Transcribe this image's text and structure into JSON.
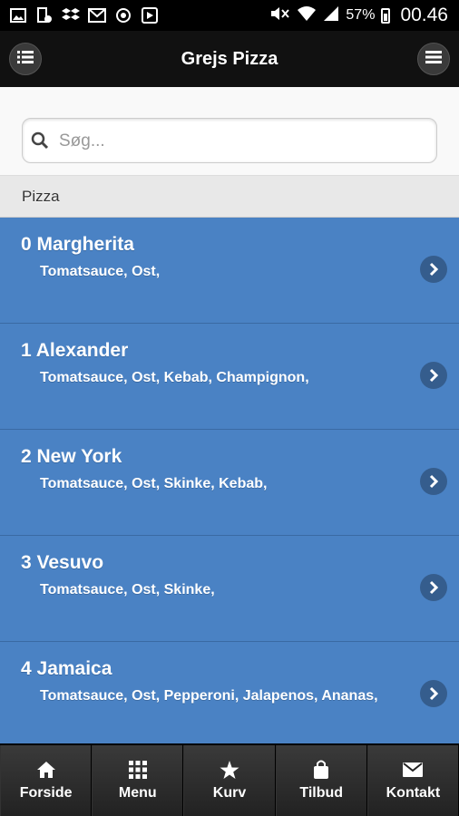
{
  "status_bar": {
    "battery": "57%",
    "time": "00.46",
    "icons": [
      "image-icon",
      "battery-saver-icon",
      "dropbox-icon",
      "mail-icon",
      "sync-icon",
      "google-play-icon",
      "mute-icon",
      "wifi-icon",
      "signal-icon",
      "battery-icon"
    ]
  },
  "header": {
    "title": "Grejs Pizza",
    "left_icon": "list-icon",
    "right_icon": "menu-icon"
  },
  "search": {
    "placeholder": "Søg...",
    "value": ""
  },
  "section": {
    "title": "Pizza"
  },
  "items": [
    {
      "title": "0 Margherita",
      "desc": "Tomatsauce, Ost,"
    },
    {
      "title": "1 Alexander",
      "desc": "Tomatsauce, Ost, Kebab, Champignon,"
    },
    {
      "title": "2 New York",
      "desc": "Tomatsauce, Ost, Skinke, Kebab,"
    },
    {
      "title": "3 Vesuvo",
      "desc": "Tomatsauce, Ost, Skinke,"
    },
    {
      "title": "4 Jamaica",
      "desc": "Tomatsauce, Ost, Pepperoni, Jalapenos, Ananas,"
    }
  ],
  "navbar": [
    {
      "label": "Forside",
      "icon": "home-icon"
    },
    {
      "label": "Menu",
      "icon": "grid-icon"
    },
    {
      "label": "Kurv",
      "icon": "star-icon"
    },
    {
      "label": "Tilbud",
      "icon": "bag-icon"
    },
    {
      "label": "Kontakt",
      "icon": "mail-icon"
    }
  ],
  "colors": {
    "accent": "#4a82c4",
    "header": "#111111",
    "navbar": "#222222"
  }
}
